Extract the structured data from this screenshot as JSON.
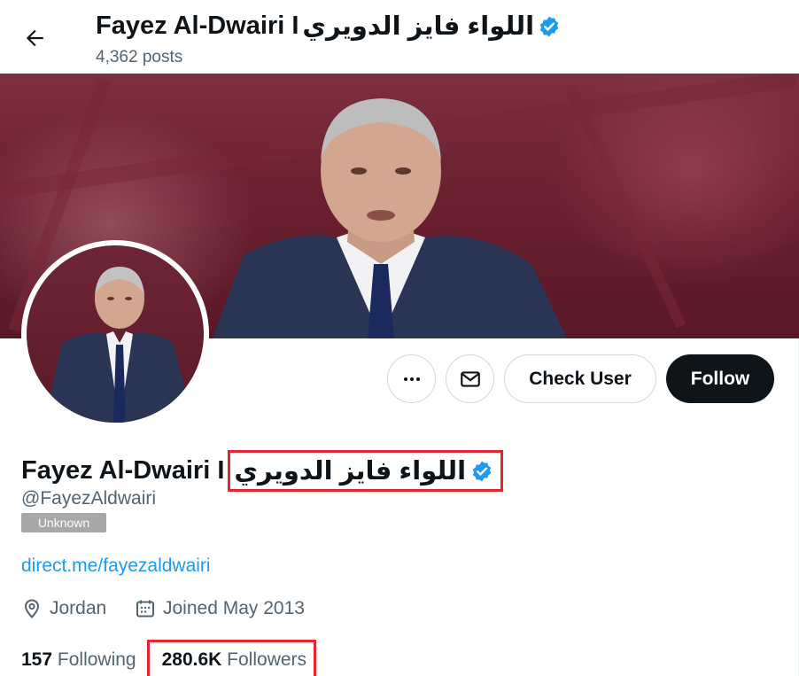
{
  "header": {
    "back_icon": "arrow-left-icon",
    "title_en": "Fayez Al-Dwairi I",
    "title_ar": "اللواء فايز الدويري",
    "posts_count": "4,362 posts"
  },
  "banner": {
    "description": "profile-banner-photo"
  },
  "actions": {
    "more_icon": "more-dots-icon",
    "message_icon": "envelope-icon",
    "check_user_label": "Check User",
    "follow_label": "Follow"
  },
  "profile": {
    "name_en": "Fayez Al-Dwairi I",
    "name_ar": "اللواء فايز الدويري",
    "verified_icon": "verified-badge-icon",
    "handle": "@FayezAldwairi",
    "badge": "Unknown",
    "website": "direct.me/fayezaldwairi",
    "location": "Jordan",
    "joined": "Joined May 2013"
  },
  "stats": {
    "following_count": "157",
    "following_label": "Following",
    "followers_count": "280.6K",
    "followers_label": "Followers"
  },
  "colors": {
    "accent_blue": "#1d9bf0",
    "verified_blue": "#1d9bf0",
    "highlight_red": "#e0252d",
    "text_primary": "#0f1419",
    "text_secondary": "#536471"
  }
}
